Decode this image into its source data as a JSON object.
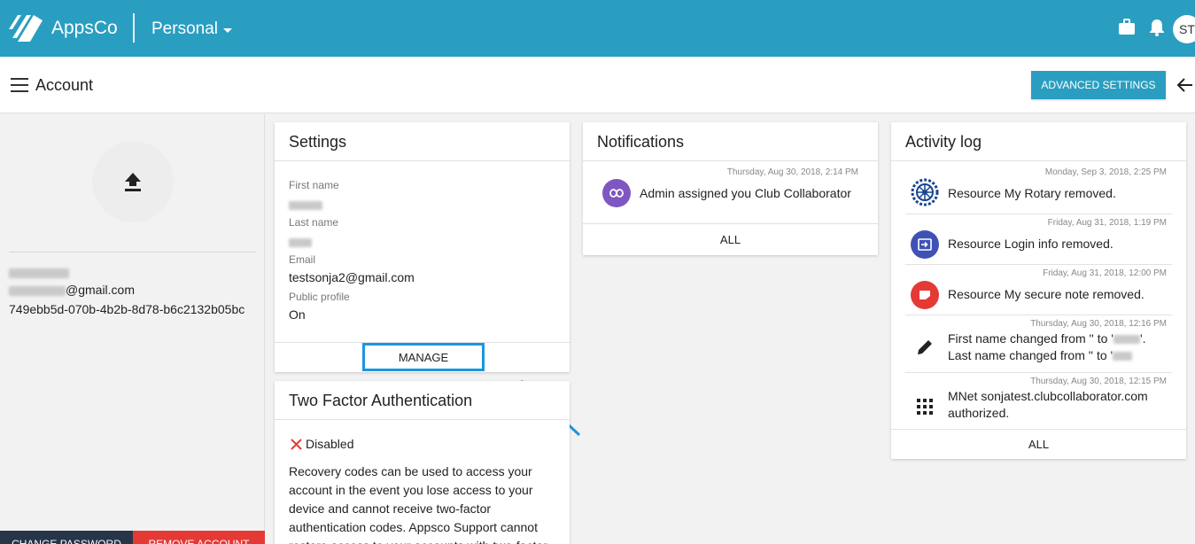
{
  "app": {
    "brand": "AppsCo",
    "workspace": "Personal",
    "avatar_initials": "ST",
    "accent": "#2a9ec0"
  },
  "header": {
    "title": "Account",
    "advanced_settings_label": "ADVANCED SETTINGS"
  },
  "profile": {
    "email_suffix": "@gmail.com",
    "id": "749ebb5d-070b-4b2b-8d78-b6c2132b05bc",
    "change_password": "CHANGE PASSWORD",
    "remove_account": "REMOVE ACCOUNT"
  },
  "settings": {
    "title": "Settings",
    "first_name_label": "First name",
    "last_name_label": "Last name",
    "email_label": "Email",
    "email_value": "testsonja2@gmail.com",
    "public_profile_label": "Public profile",
    "public_profile_value": "On",
    "manage_label": "MANAGE"
  },
  "two_factor": {
    "title": "Two Factor Authentication",
    "status": "Disabled",
    "description": "Recovery codes can be used to access your account in the event you lose access to your device and cannot receive two-factor authentication codes. Appsco Support cannot restore access to your accounts with two-factor"
  },
  "notifications": {
    "title": "Notifications",
    "items": [
      {
        "time": "Thursday, Aug 30, 2018, 2:14 PM",
        "text": "Admin assigned you Club Collaborator",
        "color": "#7e57c2"
      }
    ],
    "all_label": "ALL"
  },
  "activity": {
    "title": "Activity log",
    "items": [
      {
        "time": "Monday, Sep 3, 2018, 2:25 PM",
        "text": "Resource My Rotary removed."
      },
      {
        "time": "Friday, Aug 31, 2018, 1:19 PM",
        "text": "Resource Login info removed.",
        "color": "#3f51b5"
      },
      {
        "time": "Friday, Aug 31, 2018, 12:00 PM",
        "text": "Resource My secure note removed.",
        "color": "#e53935"
      },
      {
        "time": "Thursday, Aug 30, 2018, 12:16 PM",
        "line1": "First name changed from '' to '",
        "line2": "Last name changed from '' to '"
      },
      {
        "time": "Thursday, Aug 30, 2018, 12:15 PM",
        "line1": "MNet sonjatest.clubcollaborator.com",
        "line2": "authorized."
      }
    ],
    "all_label": "ALL"
  }
}
